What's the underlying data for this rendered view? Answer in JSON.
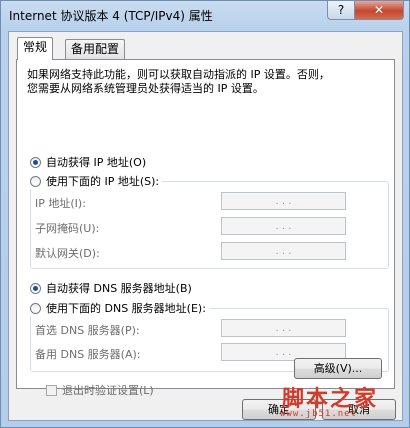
{
  "window": {
    "title": "Internet 协议版本 4 (TCP/IPv4) 属性",
    "help_glyph": "?",
    "close_glyph": "✕"
  },
  "tabs": [
    {
      "label": "常规",
      "active": true
    },
    {
      "label": "备用配置",
      "active": false
    }
  ],
  "general": {
    "description": "如果网络支持此功能，则可以获取自动指派的 IP 设置。否则，\n您需要从网络系统管理员处获得适当的 IP 设置。",
    "ip_auto_label": "自动获得 IP 地址(O)",
    "ip_manual_label": "使用下面的 IP 地址(S):",
    "ip_fields": [
      {
        "label": "IP 地址(I):",
        "value": ". . ."
      },
      {
        "label": "子网掩码(U):",
        "value": ". . ."
      },
      {
        "label": "默认网关(D):",
        "value": ". . ."
      }
    ],
    "dns_auto_label": "自动获得 DNS 服务器地址(B)",
    "dns_manual_label": "使用下面的 DNS 服务器地址(E):",
    "dns_fields": [
      {
        "label": "首选 DNS 服务器(P):",
        "value": ". . ."
      },
      {
        "label": "备用 DNS 服务器(A):",
        "value": ". . ."
      }
    ],
    "validate_label": "退出时验证设置(L)",
    "advanced_label": "高级(V)..."
  },
  "footer": {
    "ok_label": "确定",
    "cancel_label": "取消"
  },
  "watermark": {
    "text": "脚本之家",
    "url": "www.jb51.net"
  },
  "colors": {
    "selected_radio": "#1f4f93",
    "watermark": "#d23a2a"
  }
}
